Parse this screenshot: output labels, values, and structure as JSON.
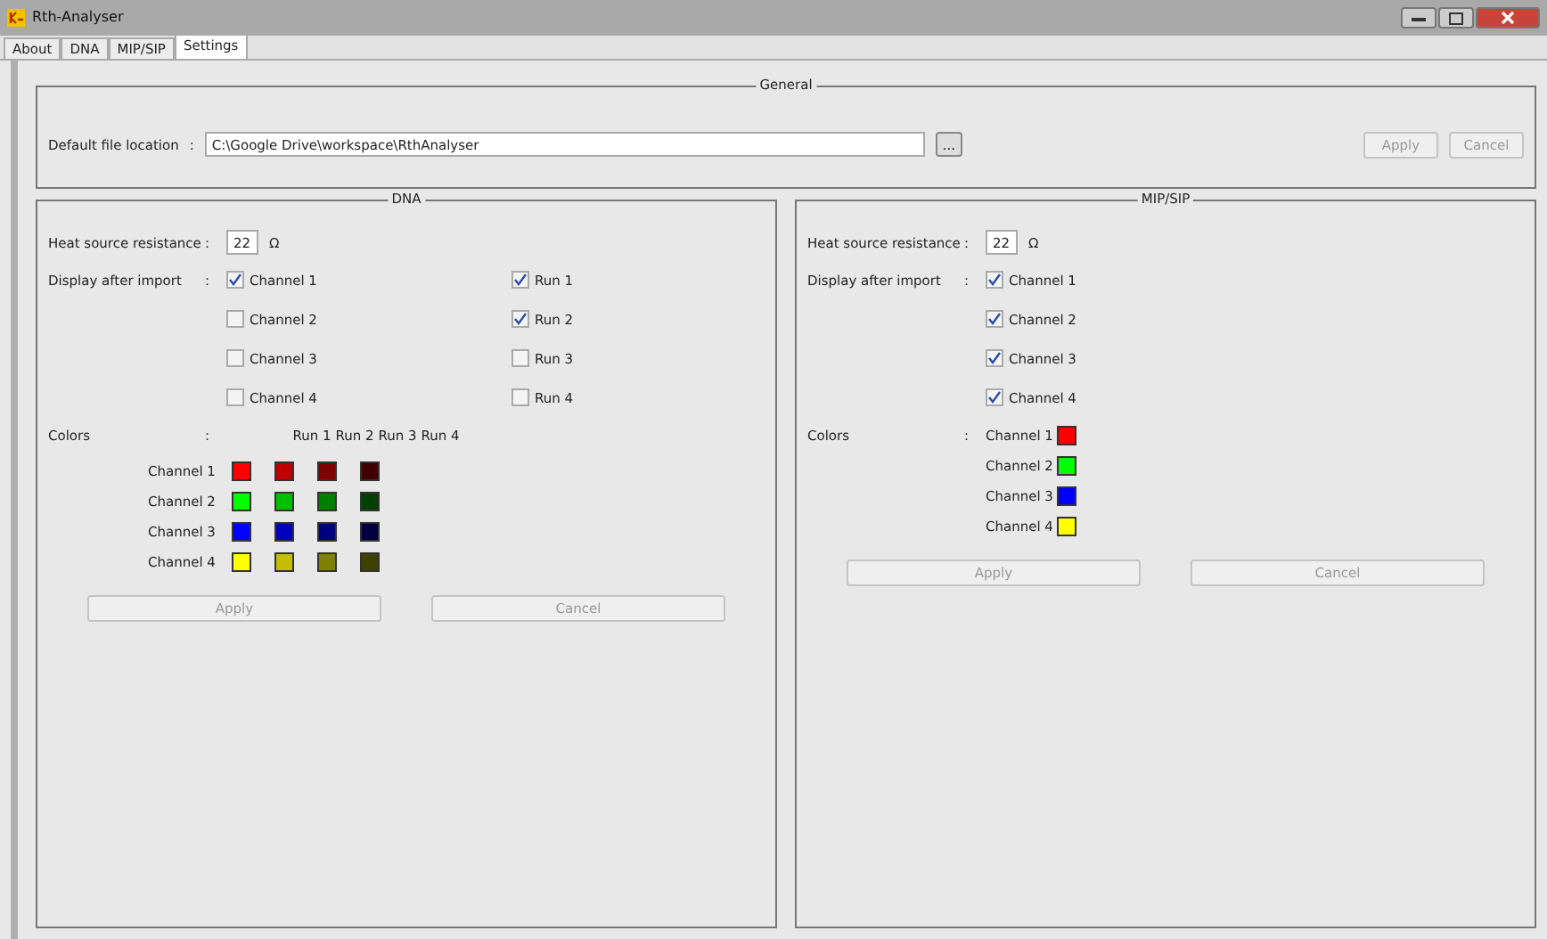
{
  "window": {
    "title": "Rth-Analyser"
  },
  "tabs": [
    {
      "label": "About",
      "selected": false
    },
    {
      "label": "DNA",
      "selected": false
    },
    {
      "label": "MIP/SIP",
      "selected": false
    },
    {
      "label": "Settings",
      "selected": true
    }
  ],
  "general": {
    "title": "General",
    "file_label": "Default file location",
    "colon": ":",
    "file_path": "C:\\Google Drive\\workspace\\RthAnalyser",
    "browse_button": "...",
    "buttons": [
      {
        "label": "Apply",
        "disabled": true
      },
      {
        "label": "Cancel",
        "disabled": true
      }
    ]
  },
  "dna": {
    "title": "DNA",
    "resistance": {
      "label": "Heat source resistance",
      "colon": ":",
      "value": "22",
      "unit": "Ω"
    },
    "display": {
      "label": "Display after import",
      "colon": ":",
      "channels": [
        {
          "label": "Channel 1",
          "checked": true
        },
        {
          "label": "Channel 2",
          "checked": false
        },
        {
          "label": "Channel 3",
          "checked": false
        },
        {
          "label": "Channel 4",
          "checked": false
        }
      ],
      "runs": [
        {
          "label": "Run 1",
          "checked": true
        },
        {
          "label": "Run 2",
          "checked": true
        },
        {
          "label": "Run 3",
          "checked": false
        },
        {
          "label": "Run 4",
          "checked": false
        }
      ]
    },
    "colors": {
      "label": "Colors",
      "colon": ":",
      "columns": [
        "Run 1",
        "Run 2",
        "Run 3",
        "Run 4"
      ],
      "rows": [
        {
          "label": "Channel 1",
          "swatches": [
            {
              "color": "#ff0000"
            },
            {
              "color": "#c00000"
            },
            {
              "color": "#800000"
            },
            {
              "color": "#400000"
            }
          ]
        },
        {
          "label": "Channel 2",
          "swatches": [
            {
              "color": "#00ff00"
            },
            {
              "color": "#00c000"
            },
            {
              "color": "#008000"
            },
            {
              "color": "#004000"
            }
          ]
        },
        {
          "label": "Channel 3",
          "swatches": [
            {
              "color": "#0000ff"
            },
            {
              "color": "#0000c0"
            },
            {
              "color": "#000080"
            },
            {
              "color": "#000040"
            }
          ]
        },
        {
          "label": "Channel 4",
          "swatches": [
            {
              "color": "#ffff00"
            },
            {
              "color": "#c0c000"
            },
            {
              "color": "#808000"
            },
            {
              "color": "#404000"
            }
          ]
        }
      ]
    },
    "buttons": [
      {
        "label": "Apply",
        "disabled": true
      },
      {
        "label": "Cancel",
        "disabled": true
      }
    ]
  },
  "mip_sip": {
    "title": "MIP/SIP",
    "resistance": {
      "label": "Heat source resistance",
      "colon": ":",
      "value": "22",
      "unit": "Ω"
    },
    "display": {
      "label": "Display after import",
      "colon": ":",
      "channels": [
        {
          "label": "Channel 1",
          "checked": true
        },
        {
          "label": "Channel 2",
          "checked": true
        },
        {
          "label": "Channel 3",
          "checked": true
        },
        {
          "label": "Channel 4",
          "checked": true
        }
      ]
    },
    "colors": {
      "label": "Colors",
      "colon": ":",
      "rows": [
        {
          "label": "Channel 1",
          "color": "#ff0000"
        },
        {
          "label": "Channel 2",
          "color": "#00ff00"
        },
        {
          "label": "Channel 3",
          "color": "#0000ff"
        },
        {
          "label": "Channel 4",
          "color": "#ffff00"
        }
      ]
    },
    "buttons": [
      {
        "label": "Apply",
        "disabled": true
      },
      {
        "label": "Cancel",
        "disabled": true
      }
    ]
  }
}
